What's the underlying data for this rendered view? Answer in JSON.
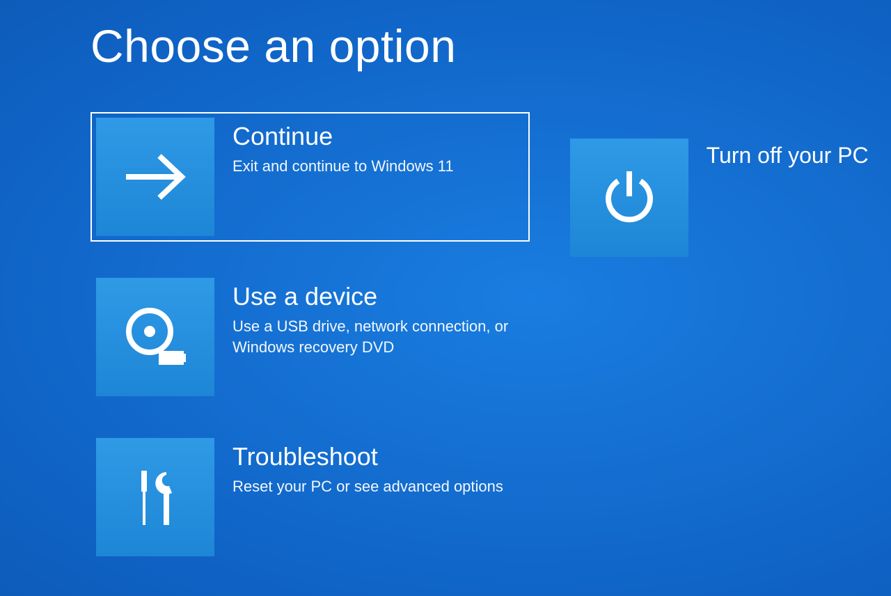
{
  "title": "Choose an option",
  "options": {
    "continue": {
      "title": "Continue",
      "description": "Exit and continue to Windows 11"
    },
    "use_device": {
      "title": "Use a device",
      "description": "Use a USB drive, network connection, or Windows recovery DVD"
    },
    "troubleshoot": {
      "title": "Troubleshoot",
      "description": "Reset your PC or see advanced options"
    },
    "turn_off": {
      "title": "Turn off your PC"
    }
  }
}
